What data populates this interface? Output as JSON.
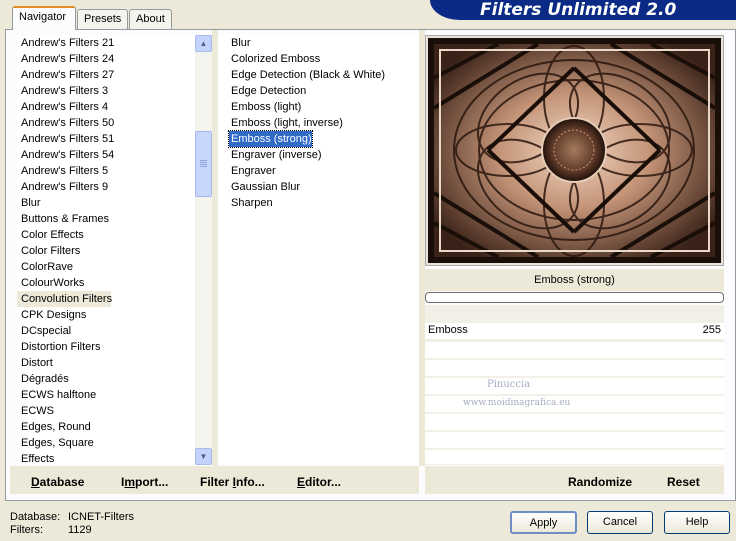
{
  "tabs": [
    "Navigator",
    "Presets",
    "About"
  ],
  "banner_title": "Filters Unlimited 2.0",
  "categories": [
    "Andrew's Filters 21",
    "Andrew's Filters 24",
    "Andrew's Filters 27",
    "Andrew's Filters 3",
    "Andrew's Filters 4",
    "Andrew's Filters 50",
    "Andrew's Filters 51",
    "Andrew's Filters 54",
    "Andrew's Filters 5",
    "Andrew's Filters 9",
    "Blur",
    "Buttons & Frames",
    "Color Effects",
    "Color Filters",
    "ColorRave",
    "ColourWorks",
    "Convolution Filters",
    "CPK Designs",
    "DCspecial",
    "Distortion Filters",
    "Distort",
    "Dégradés",
    "ECWS halftone",
    "ECWS",
    "Edges, Round",
    "Edges, Square",
    "Effects"
  ],
  "selected_category": "Convolution Filters",
  "filters": [
    "Blur",
    "Colorized Emboss",
    "Edge Detection (Black & White)",
    "Edge Detection",
    "Emboss (light)",
    "Emboss (light, inverse)",
    "Emboss (strong)",
    "Engraver (inverse)",
    "Engraver",
    "Gaussian Blur",
    "Sharpen"
  ],
  "selected_filter": "Emboss (strong)",
  "preview_label": "Emboss (strong)",
  "parameter": {
    "label": "Emboss",
    "value": "255"
  },
  "watermark": {
    "line1": "Pinuccia",
    "line2": "www.moidinagrafica.eu"
  },
  "commands": {
    "database": {
      "pre": "",
      "u": "D",
      "post": "atabase"
    },
    "import": {
      "pre": "I",
      "u": "m",
      "post": "port..."
    },
    "filter_info": {
      "pre": "Filter ",
      "u": "I",
      "post": "nfo..."
    },
    "editor": {
      "pre": "",
      "u": "E",
      "post": "ditor..."
    },
    "randomize": "Randomize",
    "reset": "Reset"
  },
  "status": {
    "database_label": "Database:",
    "database_value": "ICNET-Filters",
    "filters_label": "Filters:",
    "filters_value": "1129"
  },
  "buttons": {
    "apply": "Apply",
    "cancel": "Cancel",
    "help": "Help"
  },
  "colors": {
    "selection": "#316ac5",
    "tab_accent": "#e68b2c",
    "banner": "#0a2a86"
  }
}
